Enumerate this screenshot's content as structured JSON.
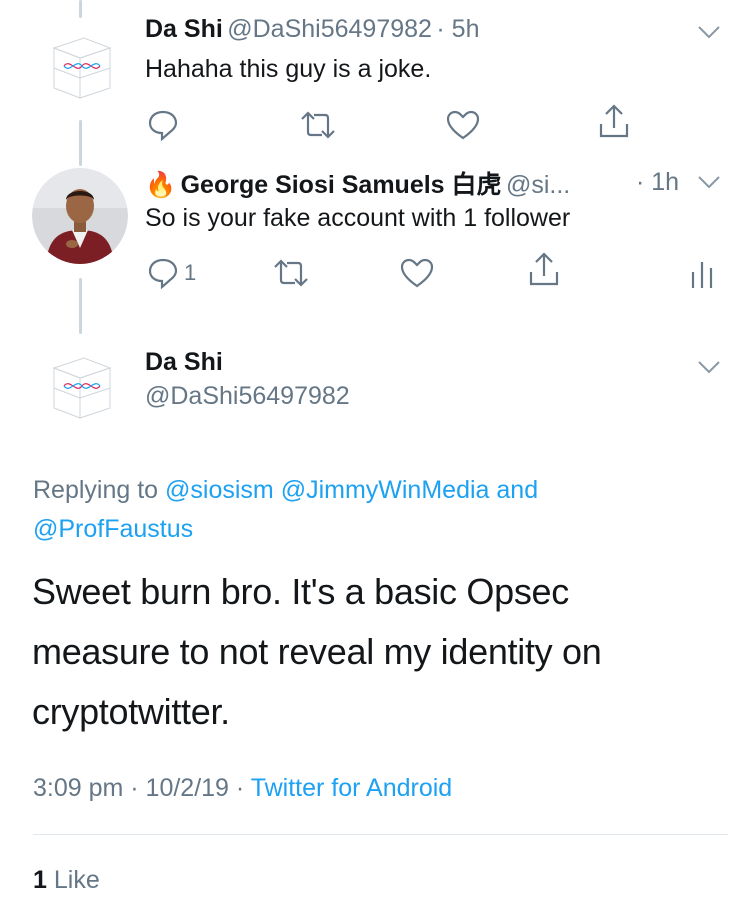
{
  "tweets": [
    {
      "name": "Da Shi",
      "handle": "@DaShi56497982",
      "time": "· 5h",
      "text": "Hahaha this guy is a joke."
    },
    {
      "emoji": "🔥",
      "name": "George Siosi Samuels 白虎",
      "handle": "@si...",
      "time": "· 1h",
      "text": "So is your fake account with 1 follower",
      "reply_count": "1"
    }
  ],
  "main_tweet": {
    "name": "Da Shi",
    "handle": "@DaShi56497982",
    "replying_prefix": "Replying to",
    "replying_to": [
      "@siosism",
      "@JimmyWinMedia",
      "@ProfFaustus"
    ],
    "replying_and": "and",
    "text_line1": "Sweet burn bro. It's a basic Opsec",
    "text_line2": "measure to not reveal my identity on",
    "text_line3": "cryptotwitter.",
    "timestamp": "3:09 pm · 10/2/19 ·",
    "source": "Twitter for Android",
    "likes_count": "1",
    "likes_label": "Like"
  },
  "colors": {
    "accent": "#1da1f2",
    "text": "#14171a",
    "muted": "#657786",
    "line": "#ccd6dd"
  }
}
